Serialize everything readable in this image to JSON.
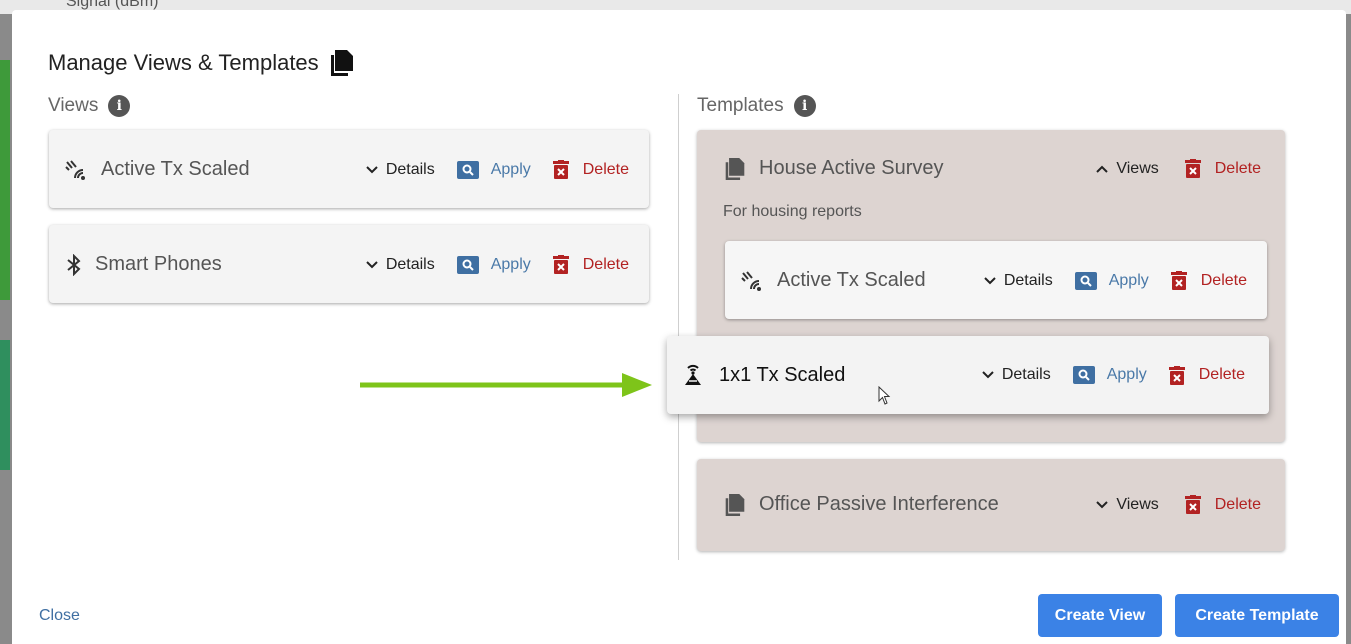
{
  "background": {
    "partial_text": "Signal (dBm)"
  },
  "dialog": {
    "title": "Manage Views & Templates",
    "views_heading": "Views",
    "templates_heading": "Templates",
    "info_glyph": "i"
  },
  "views": [
    {
      "name": "Active Tx Scaled",
      "icon": "signal-waves-icon",
      "details": "Details",
      "apply": "Apply",
      "delete": "Delete"
    },
    {
      "name": "Smart Phones",
      "icon": "bluetooth-icon",
      "details": "Details",
      "apply": "Apply",
      "delete": "Delete"
    }
  ],
  "templates": [
    {
      "name": "House Active Survey",
      "description": "For housing reports",
      "toggle": "Views",
      "expanded": true,
      "delete": "Delete",
      "views": [
        {
          "name": "Active Tx Scaled",
          "icon": "signal-waves-icon",
          "details": "Details",
          "apply": "Apply",
          "delete": "Delete"
        }
      ]
    },
    {
      "name": "Office Passive Interference",
      "toggle": "Views",
      "expanded": false,
      "delete": "Delete"
    }
  ],
  "dragging_view": {
    "name": "1x1 Tx Scaled",
    "icon": "broadcast-tower-icon",
    "details": "Details",
    "apply": "Apply",
    "delete": "Delete"
  },
  "footer": {
    "close": "Close",
    "create_view": "Create View",
    "create_template": "Create Template"
  },
  "colors": {
    "primary": "#3b82e6",
    "link": "#4a79a8",
    "danger": "#b22222",
    "template_bg": "#ddd4d1",
    "arrow": "#7ec41a"
  }
}
